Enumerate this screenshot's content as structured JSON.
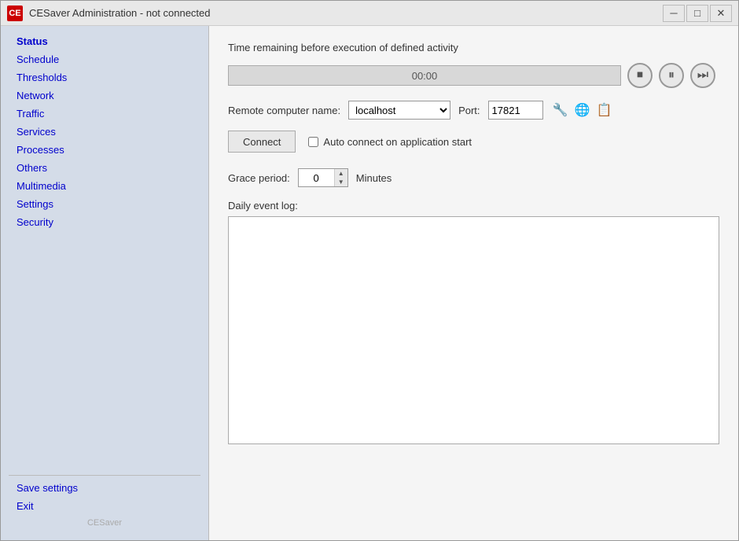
{
  "window": {
    "title": "CESaver Administration - not connected",
    "icon_label": "CE"
  },
  "titlebar": {
    "minimize_label": "─",
    "maximize_label": "□",
    "close_label": "✕"
  },
  "sidebar": {
    "items": [
      {
        "id": "status",
        "label": "Status",
        "active": true
      },
      {
        "id": "schedule",
        "label": "Schedule",
        "active": false
      },
      {
        "id": "thresholds",
        "label": "Thresholds",
        "active": false
      },
      {
        "id": "network",
        "label": "Network",
        "active": false
      },
      {
        "id": "traffic",
        "label": "Traffic",
        "active": false
      },
      {
        "id": "services",
        "label": "Services",
        "active": false
      },
      {
        "id": "processes",
        "label": "Processes",
        "active": false
      },
      {
        "id": "others",
        "label": "Others",
        "active": false
      },
      {
        "id": "multimedia",
        "label": "Multimedia",
        "active": false
      },
      {
        "id": "settings",
        "label": "Settings",
        "active": false
      },
      {
        "id": "security",
        "label": "Security",
        "active": false
      }
    ],
    "bottom_items": [
      {
        "id": "save-settings",
        "label": "Save settings"
      },
      {
        "id": "exit",
        "label": "Exit"
      }
    ],
    "footer_label": "CESaver"
  },
  "main": {
    "time_remaining_label": "Time remaining before execution of defined activity",
    "timer_value": "00:00",
    "remote_computer_label": "Remote computer name:",
    "remote_computer_value": "localhost",
    "port_label": "Port:",
    "port_value": "17821",
    "connect_button_label": "Connect",
    "auto_connect_label": "Auto connect on application start",
    "grace_period_label": "Grace period:",
    "grace_period_value": "0",
    "minutes_label": "Minutes",
    "daily_event_log_label": "Daily event log:",
    "log_content": ""
  },
  "icons": {
    "stop": "⏹",
    "pause": "⏸",
    "next": "⏭",
    "filter": "▼",
    "globe": "🌐",
    "list": "≡"
  }
}
